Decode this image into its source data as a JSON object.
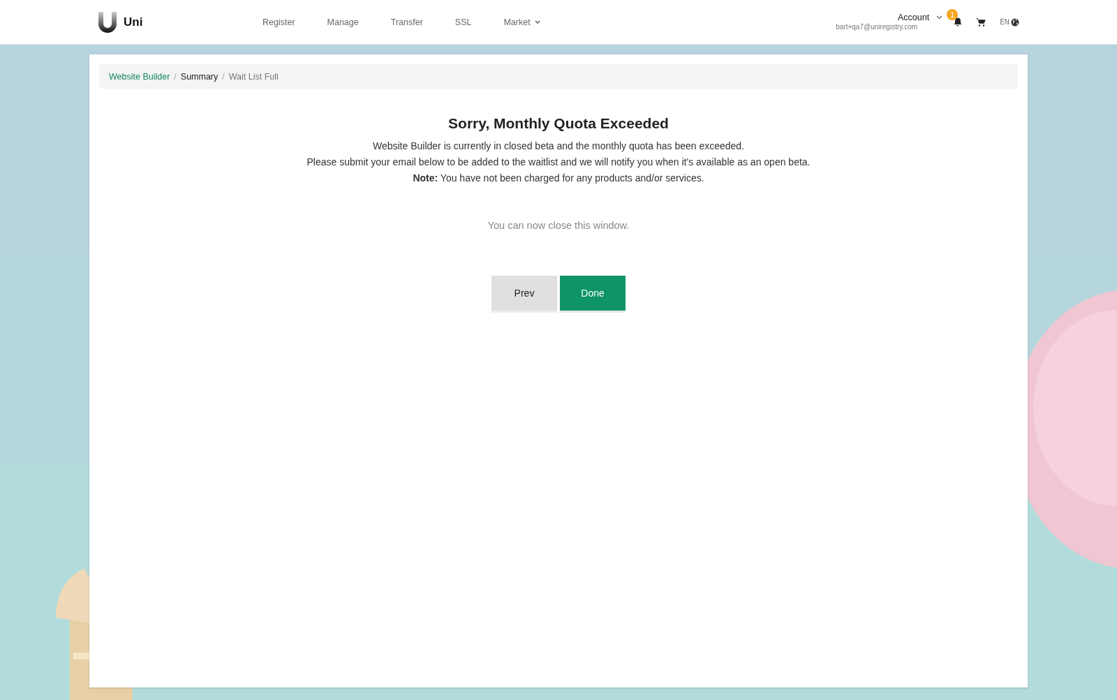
{
  "header": {
    "logo": "Uni",
    "nav": [
      {
        "label": "Register",
        "has_menu": false
      },
      {
        "label": "Manage",
        "has_menu": false
      },
      {
        "label": "Transfer",
        "has_menu": false
      },
      {
        "label": "SSL",
        "has_menu": false
      },
      {
        "label": "Market",
        "has_menu": true
      }
    ],
    "account": {
      "label": "Account",
      "email": "bart+qa7@uniregistry.com",
      "badge": "1"
    },
    "language": "EN"
  },
  "breadcrumb_separator": "/",
  "breadcrumb": [
    {
      "label": "Website Builder",
      "kind": "link"
    },
    {
      "label": "Summary",
      "kind": "page"
    },
    {
      "label": "Wait List Full",
      "kind": "current"
    }
  ],
  "title": "Sorry, Monthly Quota Exceeded",
  "message": [
    "Website Builder is currently in closed beta and the monthly quota has been exceeded.",
    "Please submit your email below to be added to the waitlist and we will notify you when it's available as an open beta.",
    "**Note:** You have not been charged for any products and/or services."
  ],
  "close_note": "You can now close this window.",
  "buttons": [
    {
      "label": "Prev",
      "kind": "secondary"
    },
    {
      "label": "Done",
      "kind": "primary"
    }
  ]
}
